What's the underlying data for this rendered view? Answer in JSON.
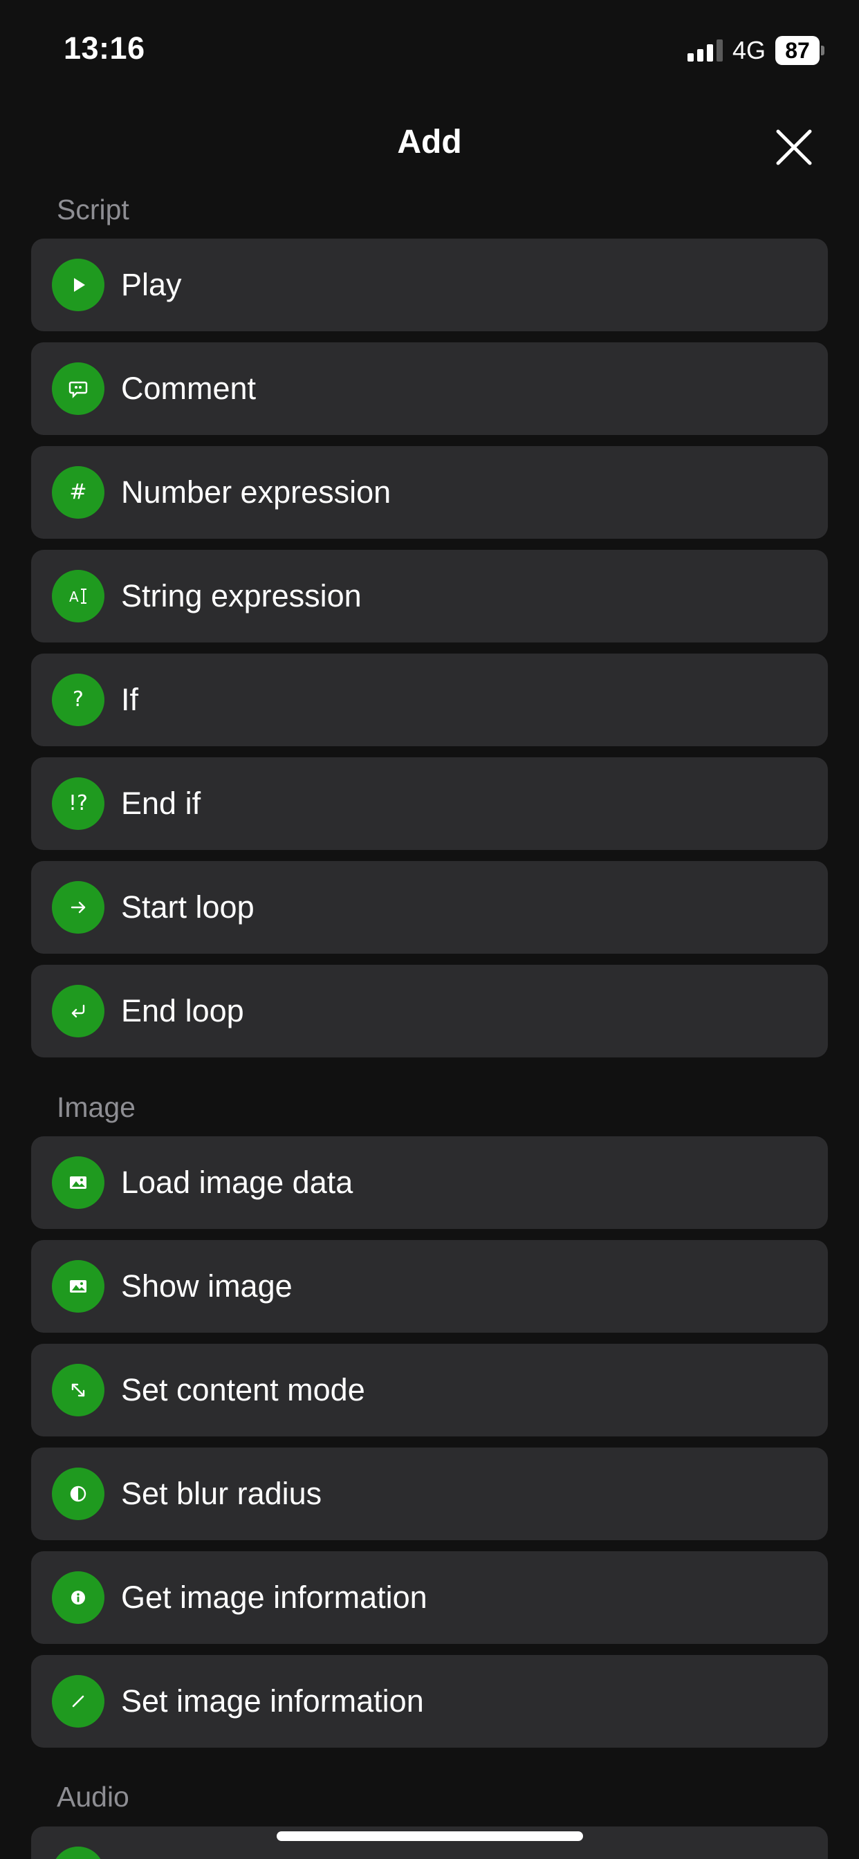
{
  "status_bar": {
    "time": "13:16",
    "network": "4G",
    "battery": "87"
  },
  "header": {
    "title": "Add"
  },
  "sections": {
    "script": {
      "label": "Script",
      "items": [
        {
          "label": "Play",
          "icon": "play-icon"
        },
        {
          "label": "Comment",
          "icon": "comment-icon"
        },
        {
          "label": "Number expression",
          "icon": "hash-icon"
        },
        {
          "label": "String expression",
          "icon": "text-cursor-icon"
        },
        {
          "label": "If",
          "icon": "question-icon"
        },
        {
          "label": "End if",
          "icon": "exclamation-question-icon"
        },
        {
          "label": "Start loop",
          "icon": "arrow-right-icon"
        },
        {
          "label": "End loop",
          "icon": "return-arrow-icon"
        }
      ]
    },
    "image": {
      "label": "Image",
      "items": [
        {
          "label": "Load image data",
          "icon": "photo-icon"
        },
        {
          "label": "Show image",
          "icon": "photo-icon"
        },
        {
          "label": "Set content mode",
          "icon": "resize-arrows-icon"
        },
        {
          "label": "Set blur radius",
          "icon": "half-circle-icon"
        },
        {
          "label": "Get image information",
          "icon": "info-icon"
        },
        {
          "label": "Set image information",
          "icon": "pencil-icon"
        }
      ]
    },
    "audio": {
      "label": "Audio"
    }
  },
  "colors": {
    "background": "#111111",
    "row": "#2c2c2e",
    "accent": "#1f9a1f",
    "section_label": "#8e8e93"
  }
}
